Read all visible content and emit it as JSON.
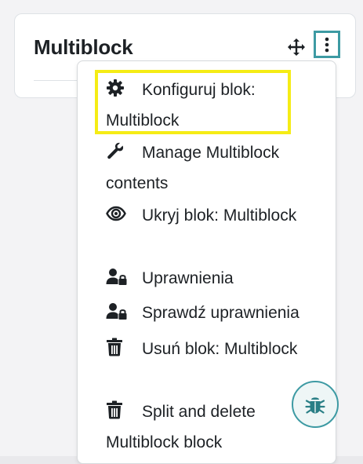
{
  "block": {
    "title": "Multiblock"
  },
  "menu": {
    "items": [
      {
        "icon": "gear-icon",
        "label": "Konfiguruj blok: Multiblock"
      },
      {
        "icon": "wrench-icon",
        "label": "Manage Multiblock contents"
      },
      {
        "icon": "eye-icon",
        "label": "Ukryj blok: Multiblock"
      },
      {
        "icon": "user-lock-icon",
        "label": "Uprawnienia"
      },
      {
        "icon": "user-lock-icon",
        "label": "Sprawdź uprawnienia"
      },
      {
        "icon": "trash-icon",
        "label": "Usuń blok: Multiblock"
      },
      {
        "icon": "trash-icon",
        "label": "Split and delete Multiblock block"
      }
    ]
  },
  "colors": {
    "highlight": "#f5ec15",
    "accent": "#3d9aa3",
    "text": "#1d2125"
  }
}
